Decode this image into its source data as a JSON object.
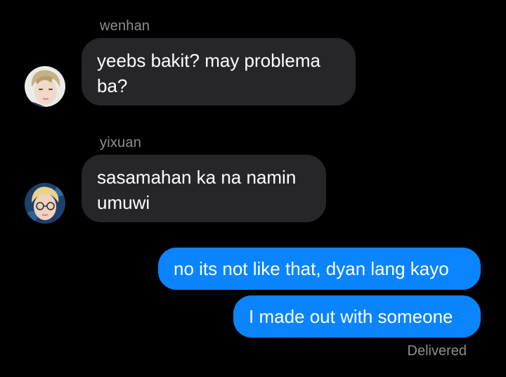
{
  "thread": {
    "messages": [
      {
        "sender": "wenhan",
        "direction": "incoming",
        "text": "yeebs bakit? may problema\nba?"
      },
      {
        "sender": "yixuan",
        "direction": "incoming",
        "text": "sasamahan ka na namin\numuwi"
      },
      {
        "direction": "outgoing",
        "text": "no its not like that, dyan lang kayo"
      },
      {
        "direction": "outgoing",
        "text": "I made out with someone"
      }
    ],
    "receipt": "Delivered"
  },
  "colors": {
    "background": "#000000",
    "incoming_bubble": "#262628",
    "outgoing_bubble": "#0a84ff",
    "secondary_text": "#8e8e93"
  }
}
